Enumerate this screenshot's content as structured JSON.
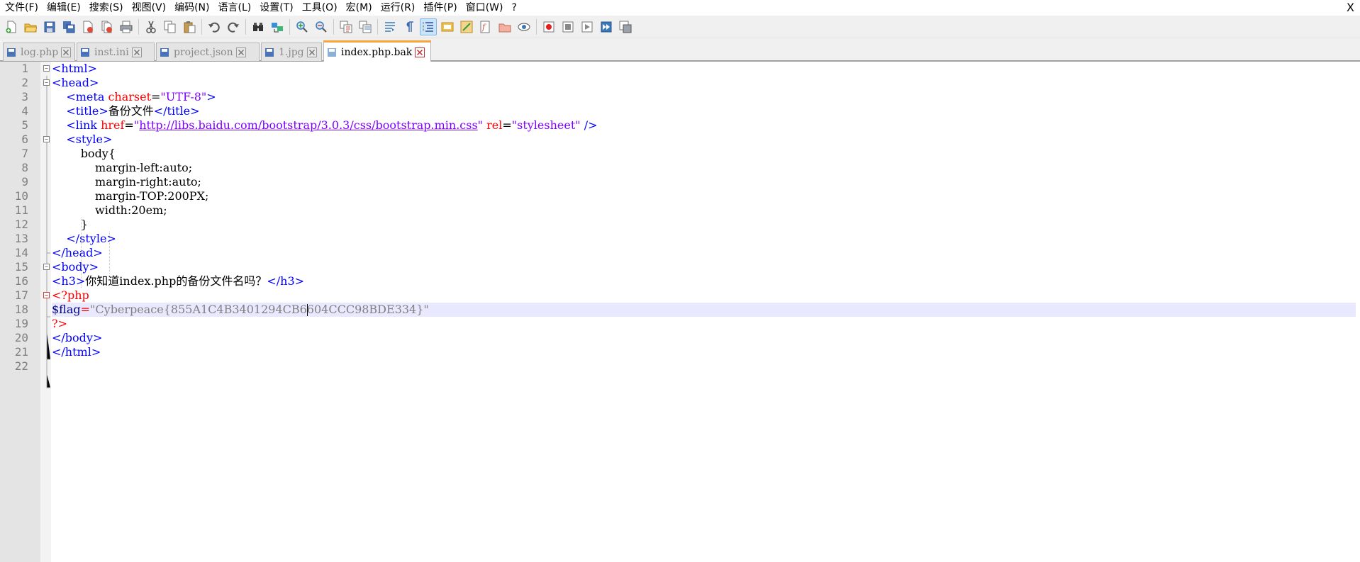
{
  "menu": {
    "items": [
      "文件(F)",
      "编辑(E)",
      "搜索(S)",
      "视图(V)",
      "编码(N)",
      "语言(L)",
      "设置(T)",
      "工具(O)",
      "宏(M)",
      "运行(R)",
      "插件(P)",
      "窗口(W)",
      "?"
    ],
    "close": "X"
  },
  "toolbar": {
    "buttons": [
      "new-file-icon",
      "open-file-icon",
      "save-icon",
      "save-all-icon",
      "close-icon",
      "close-all-icon",
      "print-icon",
      "cut-icon",
      "copy-icon",
      "paste-icon",
      "undo-icon",
      "redo-icon",
      "find-icon",
      "replace-icon",
      "zoom-in-icon",
      "zoom-out-icon",
      "sync-vertical-icon",
      "sync-horizontal-icon",
      "word-wrap-icon",
      "show-all-chars-icon",
      "indent-guide-icon",
      "user-language-icon",
      "doc-map-icon",
      "function-list-icon",
      "folder-workspace-icon",
      "monitor-icon",
      "record-macro-icon",
      "stop-record-icon",
      "play-macro-icon",
      "run-macro-multiple-icon",
      "save-macro-icon"
    ],
    "active": "indent-guide-icon"
  },
  "tabs": [
    {
      "label": "log.php",
      "active": false
    },
    {
      "label": "inst.ini",
      "active": false
    },
    {
      "label": "project.json",
      "active": false
    },
    {
      "label": "1.jpg",
      "active": false
    },
    {
      "label": "index.php.bak",
      "active": true
    }
  ],
  "editor": {
    "current_line": 18,
    "lines": [
      {
        "n": "1",
        "text": "<html>"
      },
      {
        "n": "2",
        "text": "<head>"
      },
      {
        "n": "3",
        "text": "    <meta charset=\"UTF-8\">"
      },
      {
        "n": "4",
        "text": "    <title>备份文件</title>"
      },
      {
        "n": "5",
        "text": "    <link href=\"http://libs.baidu.com/bootstrap/3.0.3/css/bootstrap.min.css\" rel=\"stylesheet\" />"
      },
      {
        "n": "6",
        "text": "    <style>"
      },
      {
        "n": "7",
        "text": "        body{"
      },
      {
        "n": "8",
        "text": "            margin-left:auto;"
      },
      {
        "n": "9",
        "text": "            margin-right:auto;"
      },
      {
        "n": "10",
        "text": "            margin-TOP:200PX;"
      },
      {
        "n": "11",
        "text": "            width:20em;"
      },
      {
        "n": "12",
        "text": "        }"
      },
      {
        "n": "13",
        "text": "    </style>"
      },
      {
        "n": "14",
        "text": "</head>"
      },
      {
        "n": "15",
        "text": "<body>"
      },
      {
        "n": "16",
        "text": "<h3>你知道index.php的备份文件名吗？</h3>"
      },
      {
        "n": "17",
        "text": "<?php"
      },
      {
        "n": "18",
        "text": "$flag=\"Cyberpeace{855A1C4B3401294CB6604CCC98BDE334}\""
      },
      {
        "n": "19",
        "text": "?>"
      },
      {
        "n": "20",
        "text": "</body>"
      },
      {
        "n": "21",
        "text": "</html>"
      },
      {
        "n": "22",
        "text": ""
      }
    ]
  },
  "colors": {
    "tag": "#0000ff",
    "attribute": "#ff0000",
    "string": "#8000ff",
    "php_delimiter": "#ff0000",
    "php_variable": "#000080",
    "php_string": "#808080",
    "active_tab_accent": "#f5a53a",
    "current_line_bg": "#e8e8ff"
  }
}
